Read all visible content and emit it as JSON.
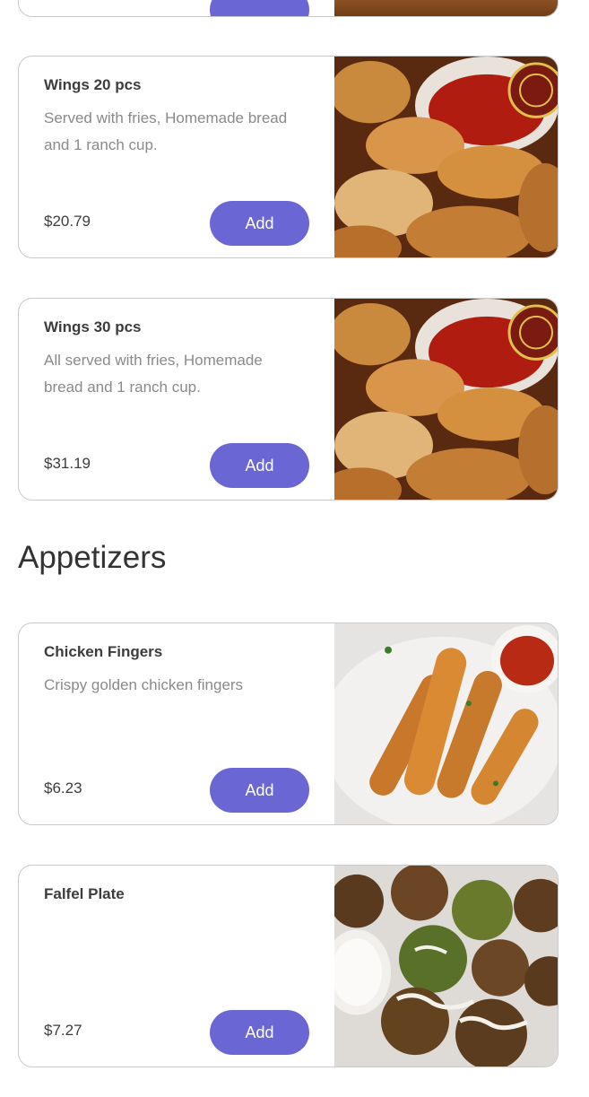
{
  "menu": {
    "items_top": [
      {
        "title": "Wings 20 pcs",
        "description": "Served with fries, Homemade bread and 1 ranch cup.",
        "price": "$20.79",
        "add_label": "Add",
        "image": "wings-photo"
      },
      {
        "title": "Wings 30 pcs",
        "description": "All served with fries, Homemade bread and 1 ranch cup.",
        "price": "$31.19",
        "add_label": "Add",
        "image": "wings-photo"
      }
    ],
    "appetizers": {
      "heading": "Appetizers",
      "items": [
        {
          "title": "Chicken Fingers",
          "description": "Crispy golden chicken fingers",
          "price": "$6.23",
          "add_label": "Add",
          "image": "chicken-fingers-photo"
        },
        {
          "title": "Falfel Plate",
          "description": "",
          "price": "$7.27",
          "add_label": "Add",
          "image": "falafel-photo"
        }
      ]
    }
  },
  "colors": {
    "accent": "#6a66d4",
    "border": "#c9c9c9",
    "muted_text": "#8a8a8a"
  }
}
